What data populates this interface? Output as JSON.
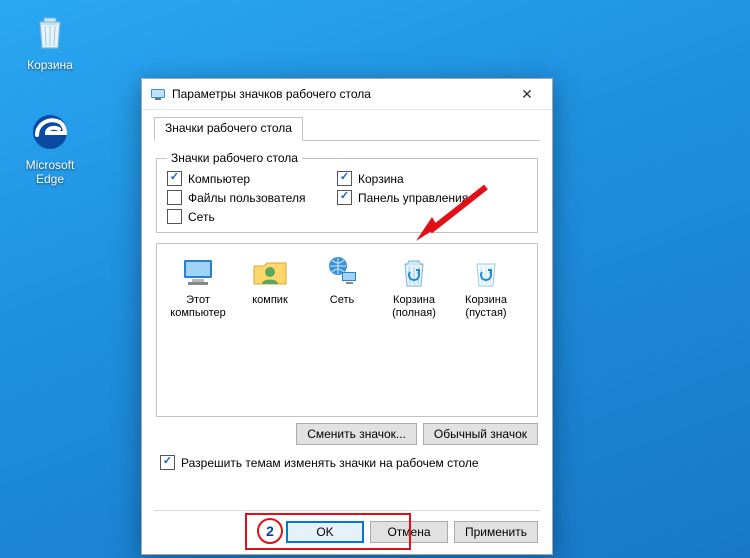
{
  "desktop": {
    "recycle_label": "Корзина",
    "edge_label": "Microsoft Edge"
  },
  "dialog": {
    "title": "Параметры значков рабочего стола",
    "tab": "Значки рабочего стола",
    "group_legend": "Значки рабочего стола",
    "checks": {
      "computer": {
        "label": "Компьютер",
        "checked": true
      },
      "recycle": {
        "label": "Корзина",
        "checked": true
      },
      "userfiles": {
        "label": "Файлы пользователя",
        "checked": false
      },
      "controlpanel": {
        "label": "Панель управления",
        "checked": true
      },
      "network": {
        "label": "Сеть",
        "checked": false
      }
    },
    "icons": [
      {
        "id": "pc",
        "label": "Этот компьютер"
      },
      {
        "id": "user",
        "label": "компик"
      },
      {
        "id": "net",
        "label": "Сеть"
      },
      {
        "id": "bin_full",
        "label": "Корзина (полная)"
      },
      {
        "id": "bin_empty",
        "label": "Корзина (пустая)"
      }
    ],
    "btn_change": "Сменить значок...",
    "btn_default": "Обычный значок",
    "allow_themes": {
      "label": "Разрешить темам изменять значки на рабочем столе",
      "checked": true
    },
    "btn_ok": "OK",
    "btn_cancel": "Отмена",
    "btn_apply": "Применить"
  },
  "annotation": {
    "step": "2"
  }
}
